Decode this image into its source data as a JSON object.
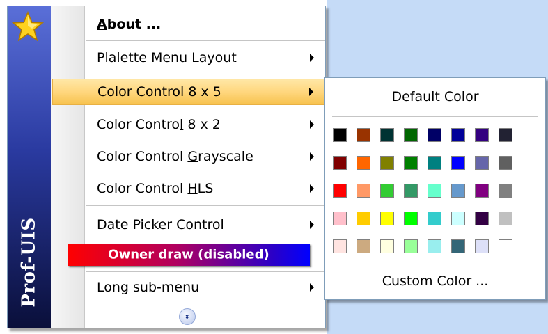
{
  "sidebar": {
    "text": "Prof-UIS",
    "icon": "star-icon"
  },
  "menu": {
    "items": [
      {
        "pre": "",
        "u": "A",
        "post": "bout ...",
        "submenu": false,
        "bold": true
      },
      {
        "pre": "Plalette Menu Layout",
        "u": "",
        "post": "",
        "submenu": true
      },
      {
        "pre": "",
        "u": "C",
        "post": "olor Control 8 x 5",
        "submenu": true,
        "highlighted": true
      },
      {
        "pre": "Color Contro",
        "u": "l",
        "post": " 8 x 2",
        "submenu": true
      },
      {
        "pre": "Color Control ",
        "u": "G",
        "post": "rayscale",
        "submenu": true
      },
      {
        "pre": "Color Control ",
        "u": "H",
        "post": "LS",
        "submenu": true
      },
      {
        "pre": "",
        "u": "D",
        "post": "ate Picker Control",
        "submenu": true
      },
      {
        "pre": "Long sub-menu",
        "u": "",
        "post": "",
        "submenu": true
      }
    ],
    "owner_draw": "Owner draw (disabled)",
    "expand_icon": "double-chevron-down-icon",
    "expand_glyph": "»"
  },
  "palette": {
    "default_label": "Default Color",
    "custom_label": "Custom Color ...",
    "colors": [
      [
        "#000000",
        "#993300",
        "#003333",
        "#006600",
        "#000066",
        "#000099",
        "#330080",
        "#222233"
      ],
      [
        "#800000",
        "#ff6600",
        "#808000",
        "#008000",
        "#008080",
        "#0000ff",
        "#6666aa",
        "#606060"
      ],
      [
        "#ff0000",
        "#ff9966",
        "#33cc33",
        "#339966",
        "#66ffcc",
        "#6699cc",
        "#800080",
        "#808080"
      ],
      [
        "#ffc0cb",
        "#ffcc00",
        "#ffff00",
        "#00ff00",
        "#33cccc",
        "#ccffff",
        "#330044",
        "#c0c0c0"
      ],
      [
        "#ffe4e1",
        "#ccaa80",
        "#ffffe0",
        "#99ff99",
        "#99eeee",
        "#336677",
        "#dde0f8",
        "#ffffff"
      ]
    ]
  }
}
